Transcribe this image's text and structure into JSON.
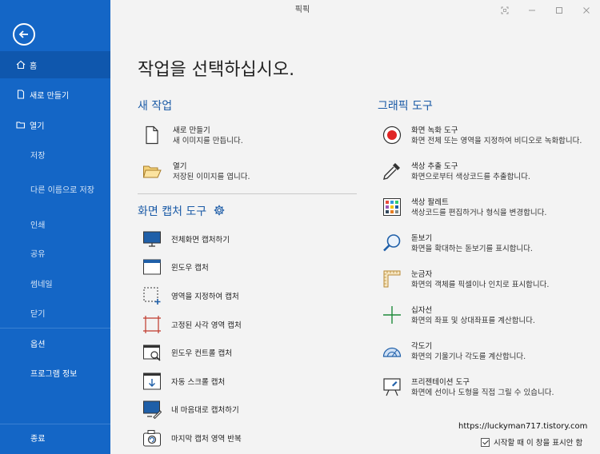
{
  "window": {
    "title": "픽픽"
  },
  "sidebar": {
    "items": [
      {
        "label": "홈",
        "icon": "home-icon"
      },
      {
        "label": "새로 만들기",
        "icon": "new-file-icon"
      },
      {
        "label": "열기",
        "icon": "folder-icon"
      },
      {
        "label": "저장"
      },
      {
        "label": "다른 이름으로 저장"
      },
      {
        "label": "인쇄"
      },
      {
        "label": "공유"
      },
      {
        "label": "썸네일"
      },
      {
        "label": "닫기"
      },
      {
        "label": "옵션"
      },
      {
        "label": "프로그램 정보"
      },
      {
        "label": "종료"
      }
    ]
  },
  "main": {
    "heading": "작업을 선택하십시오.",
    "new_task": {
      "title": "새 작업",
      "items": [
        {
          "title": "새로 만들기",
          "desc": "새 이미지를 만듭니다."
        },
        {
          "title": "열기",
          "desc": "저장된 이미지를 엽니다."
        }
      ]
    },
    "capture": {
      "title": "화면 캡처 도구",
      "items": [
        "전체화면 캡처하기",
        "윈도우 캡처",
        "영역을 지정하여 캡처",
        "고정된 사각 영역 캡처",
        "윈도우 컨트롤 캡처",
        "자동 스크롤 캡처",
        "내 마음대로 캡처하기",
        "마지막 캡처 영역 반복"
      ]
    },
    "graphic": {
      "title": "그래픽 도구",
      "items": [
        {
          "title": "화면 녹화 도구",
          "desc": "화면 전체 또는 영역을 지정하여 비디오로 녹화합니다."
        },
        {
          "title": "색상 추출 도구",
          "desc": "화면으로부터 색상코드를 추출합니다."
        },
        {
          "title": "색상 팔레트",
          "desc": "색상코드를 편집하거나 형식을 변경합니다."
        },
        {
          "title": "돋보기",
          "desc": "화면을 확대하는 돋보기를 표시합니다."
        },
        {
          "title": "눈금자",
          "desc": "화면의 객체를 픽셀이나 인치로 표시합니다."
        },
        {
          "title": "십자선",
          "desc": "화면의 좌표 및 상대좌표를 계산합니다."
        },
        {
          "title": "각도기",
          "desc": "화면의 기울기나 각도를 계산합니다."
        },
        {
          "title": "프리젠테이션 도구",
          "desc": "화면에 선이나 도형을 직접 그릴 수 있습니다."
        }
      ]
    }
  },
  "footer": {
    "url": "https://luckyman717.tistory.com",
    "checkbox_label": "시작할 때 이 창을 표시안 함",
    "checked": true
  },
  "colors": {
    "sidebar": "#1466c6",
    "sidebar_active": "#0f57ad",
    "accent": "#1a5aa6"
  }
}
